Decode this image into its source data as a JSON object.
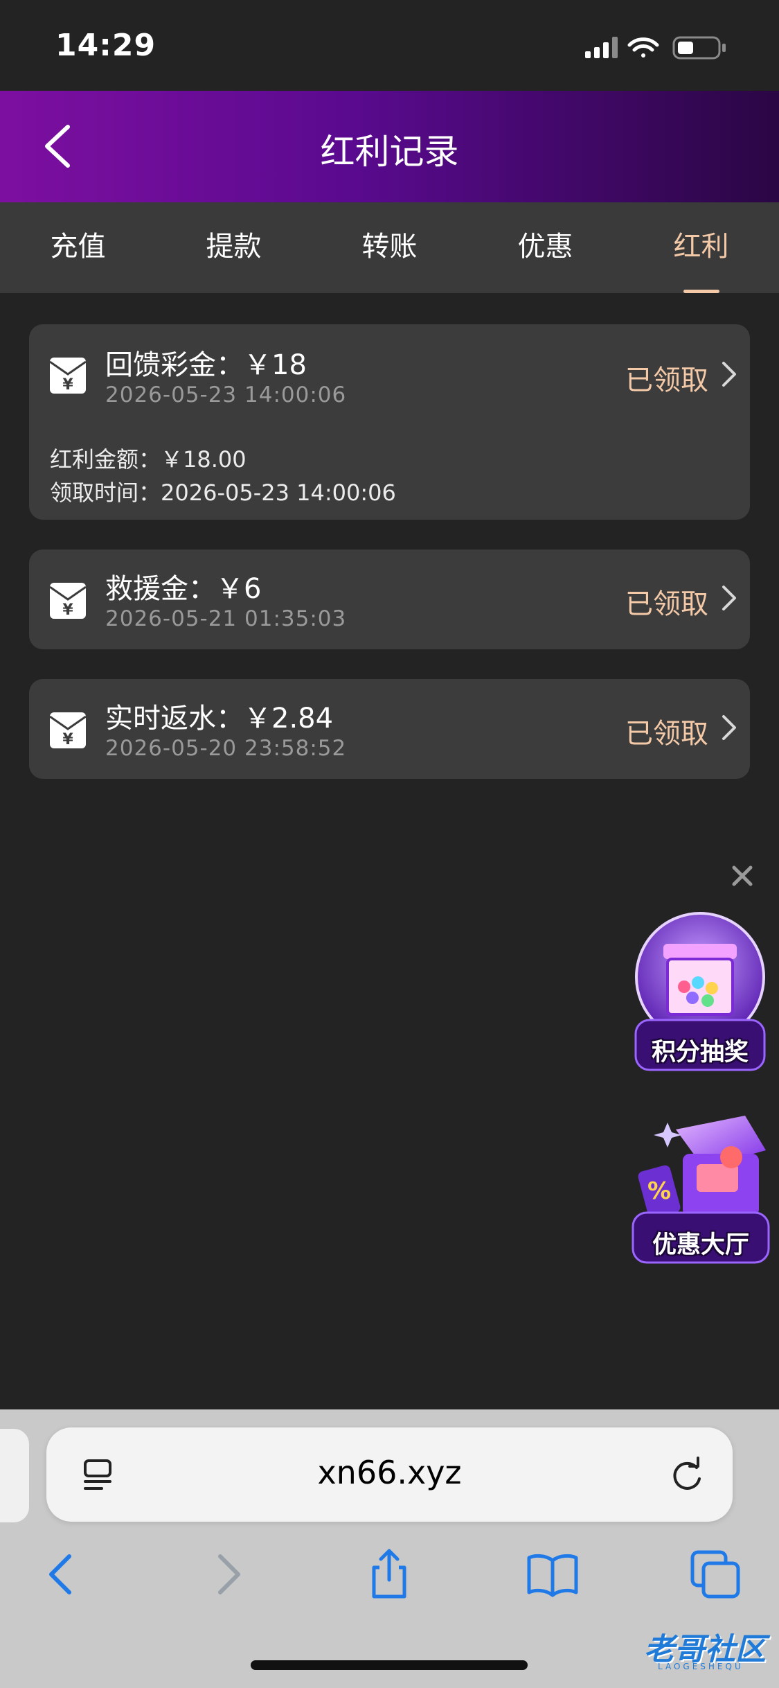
{
  "status_bar": {
    "time": "14:29"
  },
  "header": {
    "title": "红利记录"
  },
  "tabs": [
    {
      "label": "充值",
      "active": false
    },
    {
      "label": "提款",
      "active": false
    },
    {
      "label": "转账",
      "active": false
    },
    {
      "label": "优惠",
      "active": false
    },
    {
      "label": "红利",
      "active": true
    }
  ],
  "records": [
    {
      "title": "回馈彩金：￥18",
      "date": "2026-05-23 14:00:06",
      "status": "已领取",
      "expanded": true,
      "details": [
        "红利金额：￥18.00",
        "领取时间：2026-05-23 14:00:06"
      ]
    },
    {
      "title": "救援金：￥6",
      "date": "2026-05-21 01:35:03",
      "status": "已领取",
      "expanded": false
    },
    {
      "title": "实时返水：￥2.84",
      "date": "2026-05-20 23:58:52",
      "status": "已领取",
      "expanded": false
    }
  ],
  "floating": {
    "lottery_label": "积分抽奖",
    "promo_label": "优惠大厅"
  },
  "browser": {
    "url": "xn66.xyz"
  },
  "watermark": {
    "text": "老哥社区",
    "sub": "LAOGESHEQU"
  },
  "colors": {
    "accent": "#f3c9a8",
    "header_start": "#7d0fa0",
    "header_end": "#2a0644",
    "card_bg": "#3c3c3c",
    "page_bg": "#232323"
  }
}
